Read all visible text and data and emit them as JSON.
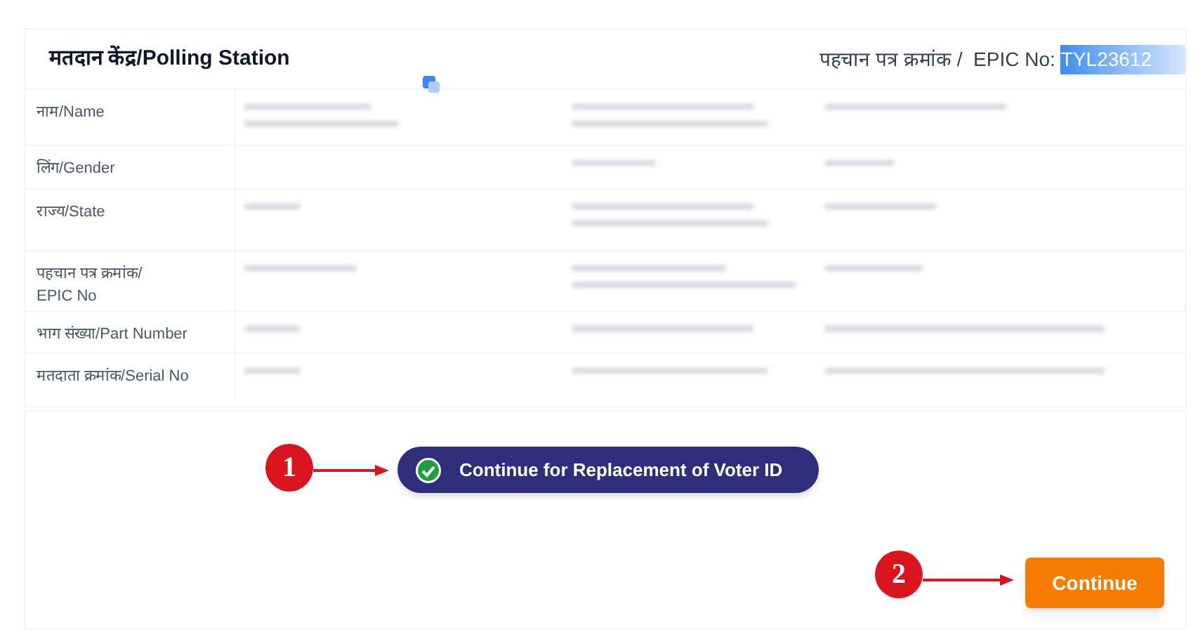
{
  "details_card": {
    "title": "मतदान केंद्र/Polling Station",
    "epic_label": "पहचान पत्र क्रमांक /  EPIC No:",
    "epic_value": "TYL23612",
    "epic_value_selected": true,
    "rows": [
      {
        "label": "नाम/Name"
      },
      {
        "label": "लिंग/Gender"
      },
      {
        "label": "राज्य/State"
      },
      {
        "label": "पहचान पत्र क्रमांक/\nEPIC No"
      },
      {
        "label": "भाग संख्या/Part Number"
      },
      {
        "label": "मतदाता क्रमांक/Serial No"
      }
    ]
  },
  "actions": {
    "replacement_button": {
      "label": "Continue for Replacement of Voter ID",
      "checked": true
    },
    "continue_button": {
      "label": "Continue"
    }
  },
  "annotations": [
    {
      "number": "1"
    },
    {
      "number": "2"
    }
  ]
}
